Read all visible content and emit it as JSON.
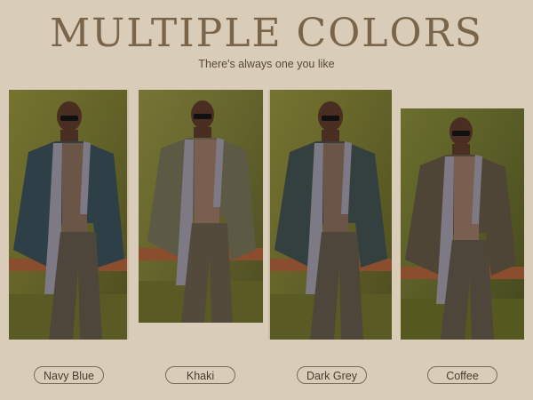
{
  "header": {
    "title": "MULTIPLE COLORS",
    "subtitle": "There's always one you like"
  },
  "variants": [
    {
      "label": "Navy Blue",
      "jacket_color": "#2e3f48",
      "bg_color": "#6b6a2a"
    },
    {
      "label": "Khaki",
      "jacket_color": "#5c5a44",
      "bg_color": "#6a6a30"
    },
    {
      "label": "Dark Grey",
      "jacket_color": "#34403f",
      "bg_color": "#6b6a2b"
    },
    {
      "label": "Coffee",
      "jacket_color": "#4e4536",
      "bg_color": "#5c5f2a"
    }
  ]
}
